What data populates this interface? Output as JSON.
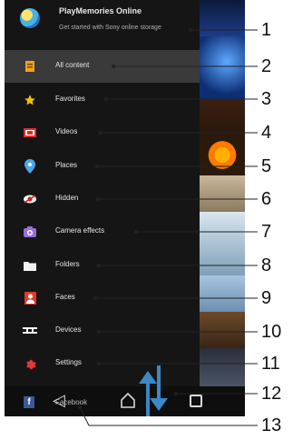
{
  "header": {
    "title": "PlayMemories Online",
    "subtitle": "Get started with Sony online storage"
  },
  "menu": [
    {
      "label": "All content",
      "icon": "all-content-icon",
      "selected": true
    },
    {
      "label": "Favorites",
      "icon": "star-icon",
      "selected": false
    },
    {
      "label": "Videos",
      "icon": "video-icon",
      "selected": false
    },
    {
      "label": "Places",
      "icon": "location-pin-icon",
      "selected": false
    },
    {
      "label": "Hidden",
      "icon": "hidden-eye-icon",
      "selected": false
    },
    {
      "label": "Camera effects",
      "icon": "camera-icon",
      "selected": false
    },
    {
      "label": "Folders",
      "icon": "folder-icon",
      "selected": false
    },
    {
      "label": "Faces",
      "icon": "faces-icon",
      "selected": false
    },
    {
      "label": "Devices",
      "icon": "devices-icon",
      "selected": false
    },
    {
      "label": "Settings",
      "icon": "gear-icon",
      "selected": false
    }
  ],
  "footer": {
    "facebook_label": "Facebook",
    "facebook_icon_letter": "f"
  },
  "navbar": {
    "back_glyph": "◁"
  },
  "callouts": [
    "1",
    "2",
    "3",
    "4",
    "5",
    "6",
    "7",
    "8",
    "9",
    "10",
    "11",
    "12",
    "13"
  ],
  "colors": {
    "drawer_bg": "#151515",
    "selected_bg": "#3a3a3a",
    "arrow_blue": "#3d8fd1"
  }
}
